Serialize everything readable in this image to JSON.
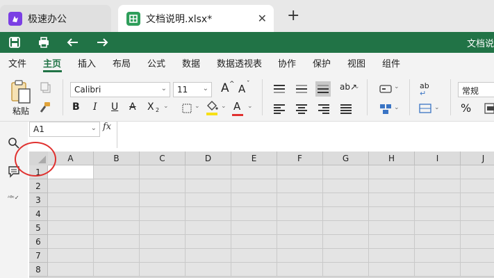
{
  "tabs": [
    {
      "title": "极速办公",
      "icon": "app-logo-icon",
      "color": "#7b3fe4"
    },
    {
      "title": "文档说明.xlsx*",
      "icon": "spreadsheet-icon",
      "color": "#2e9e5a"
    }
  ],
  "titlebar": {
    "doc_title": "文档说",
    "color": "#217346"
  },
  "menu": [
    "文件",
    "主页",
    "插入",
    "布局",
    "公式",
    "数据",
    "数据透视表",
    "协作",
    "保护",
    "视图",
    "组件"
  ],
  "ribbon": {
    "paste_label": "粘贴",
    "font_name": "Calibri",
    "font_size": "11",
    "number_format": "常规",
    "bold": "B",
    "italic": "I",
    "underline": "U",
    "strike": "A",
    "sub": "X",
    "grow": "A",
    "shrink": "A",
    "font_color": "A",
    "percent": "%",
    "wrap_label": "ab"
  },
  "formula": {
    "namebox": "A1",
    "fx": "fx",
    "value": ""
  },
  "grid": {
    "columns": [
      "A",
      "B",
      "C",
      "D",
      "E",
      "F",
      "G",
      "H",
      "I",
      "J"
    ],
    "rows": [
      "1",
      "2",
      "3",
      "4",
      "5",
      "6",
      "7",
      "8"
    ],
    "selected": "A1"
  }
}
